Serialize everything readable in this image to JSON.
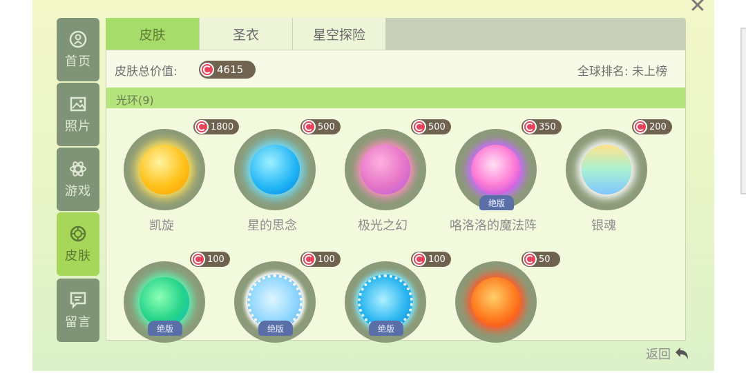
{
  "nav": {
    "items": [
      {
        "label": "首页",
        "icon": "home-icon"
      },
      {
        "label": "照片",
        "icon": "photo-icon"
      },
      {
        "label": "游戏",
        "icon": "game-icon"
      },
      {
        "label": "皮肤",
        "icon": "skin-icon"
      },
      {
        "label": "留言",
        "icon": "message-icon"
      }
    ],
    "active_index": 3
  },
  "tabs": [
    "皮肤",
    "圣衣",
    "星空探险"
  ],
  "summary": {
    "total_label": "皮肤总价值:",
    "total_value": "4615",
    "rank_label": "全球排名: 未上榜"
  },
  "category": {
    "label": "光环(9)"
  },
  "items": [
    {
      "name": "凯旋",
      "price": "1800",
      "badge": ""
    },
    {
      "name": "星的思念",
      "price": "500",
      "badge": ""
    },
    {
      "name": "极光之幻",
      "price": "500",
      "badge": ""
    },
    {
      "name": "咯洛洛的魔法阵",
      "price": "350",
      "badge": "绝版"
    },
    {
      "name": "银魂",
      "price": "200",
      "badge": ""
    },
    {
      "name": "",
      "price": "100",
      "badge": "绝版"
    },
    {
      "name": "",
      "price": "100",
      "badge": "绝版"
    },
    {
      "name": "",
      "price": "100",
      "badge": "绝版"
    },
    {
      "name": "",
      "price": "50",
      "badge": ""
    }
  ],
  "footer": {
    "back_label": "返回"
  },
  "colors": {
    "accent": "#a6dc6a",
    "coin": "#e8435d",
    "price_pill": "#6f6350"
  }
}
